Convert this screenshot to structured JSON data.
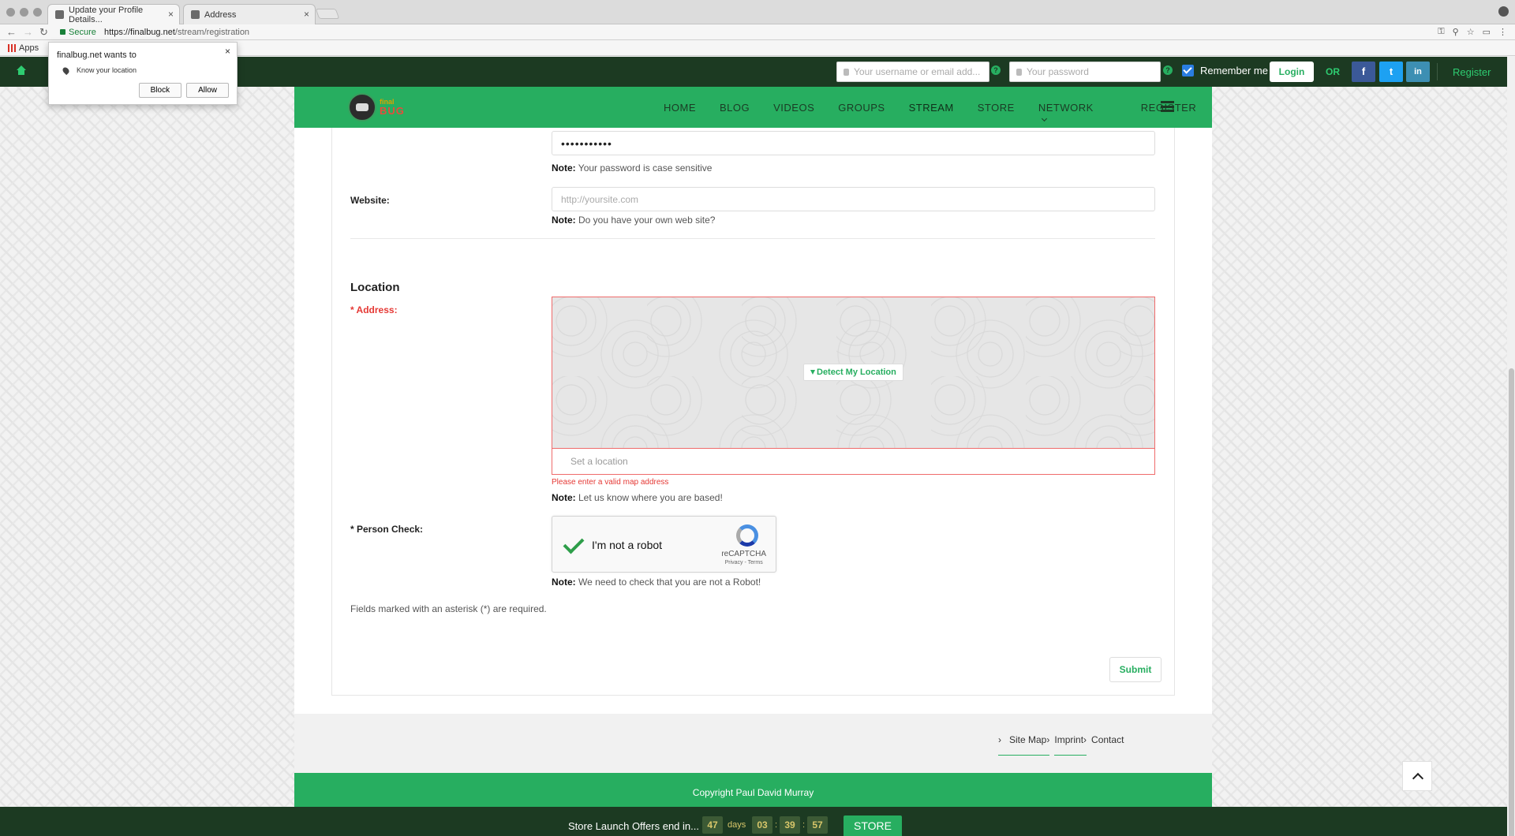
{
  "browser": {
    "tabs": [
      {
        "label": "Update your Profile Details..."
      },
      {
        "label": "Address"
      }
    ],
    "secure_label": "Secure",
    "url_host": "https://finalbug.net",
    "url_path": "/stream/registration",
    "bookmarks_apps": "Apps"
  },
  "permission": {
    "title": "finalbug.net wants to",
    "item": "Know your location",
    "block": "Block",
    "allow": "Allow",
    "close": "×"
  },
  "topbar": {
    "username_placeholder": "Your username or email add...",
    "password_placeholder": "Your password",
    "remember": "Remember me",
    "login": "Login",
    "or": "OR",
    "facebook": "f",
    "twitter": "t",
    "linkedin": "in",
    "register": "Register",
    "help": "?"
  },
  "logo": {
    "small": "final",
    "big": "BUG"
  },
  "nav": {
    "items": [
      "HOME",
      "BLOG",
      "VIDEOS",
      "GROUPS",
      "STREAM",
      "STORE",
      "NETWORK",
      "REGISTER"
    ]
  },
  "form": {
    "password_value": "•••••••••••",
    "password_note_bold": "Note:",
    "password_note": " Your password is case sensitive",
    "website_label": "Website:",
    "website_placeholder": "http://yoursite.com",
    "website_note": " Do you have your own web site?",
    "section_title": "Location",
    "address_label": "* Address:",
    "detect_btn": "Detect My Location",
    "location_placeholder": "Set a location",
    "address_error": "Please enter a valid map address",
    "address_note": " Let us know where you are based!",
    "person_label": "* Person Check:",
    "captcha_text": "I'm not a robot",
    "captcha_brand": "reCAPTCHA",
    "captcha_links": "Privacy - Terms",
    "person_note": " We need to check that you are not a Robot!",
    "required_info": "Fields marked with an asterisk (*) are required.",
    "submit": "Submit"
  },
  "footer": {
    "links": [
      "Site Map",
      "Imprint",
      "Contact"
    ],
    "copyright": "Copyright Paul David Murray"
  },
  "countdown": {
    "text": "Store Launch Offers end in...",
    "days": "47",
    "days_label": "days",
    "hours": "03",
    "minutes": "39",
    "seconds": "57",
    "sep": ":",
    "store": "STORE"
  },
  "colors": {
    "brand_green": "#27ae60",
    "dark_green": "#1c3a22",
    "error_red": "#e53935"
  }
}
